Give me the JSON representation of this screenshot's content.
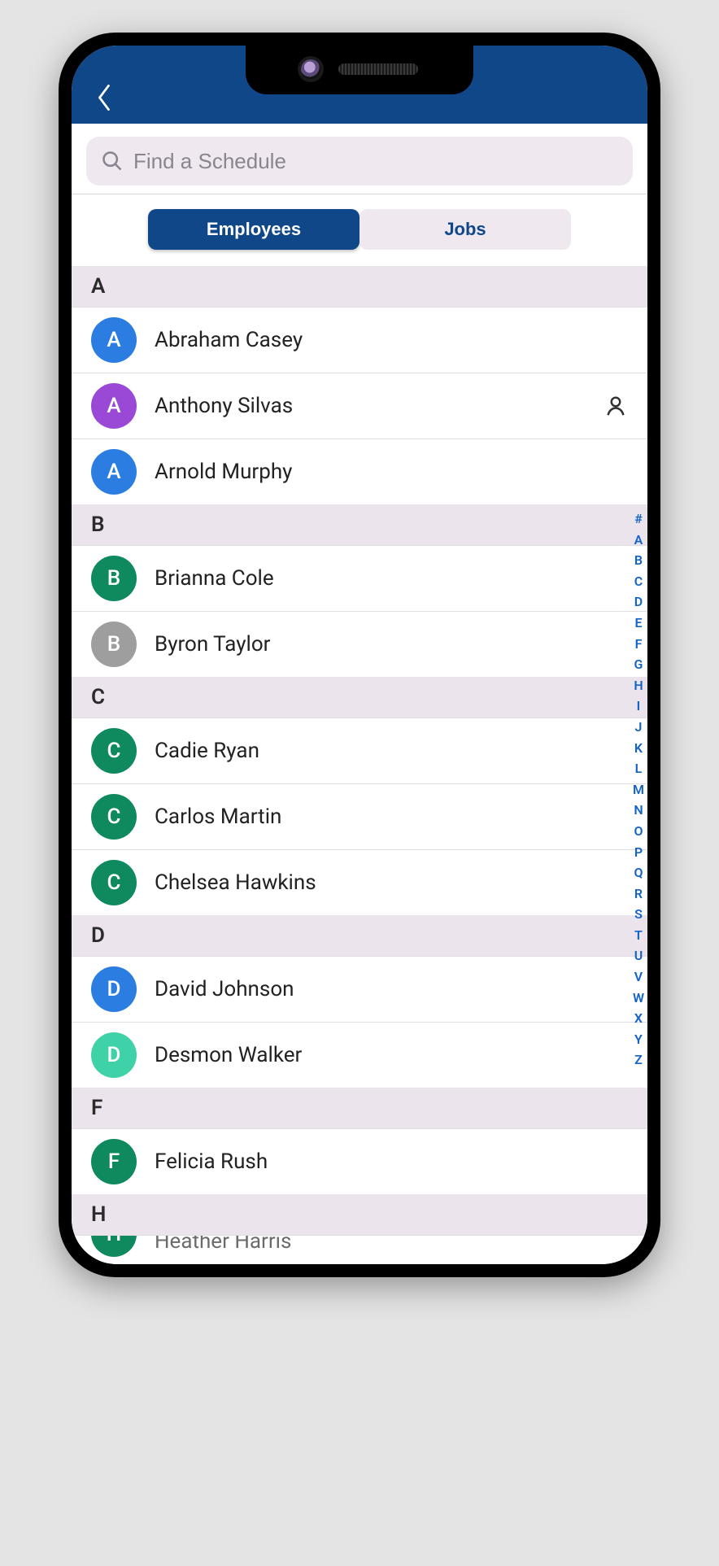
{
  "search": {
    "placeholder": "Find a Schedule"
  },
  "tabs": {
    "employees": "Employees",
    "jobs": "Jobs",
    "active": "employees"
  },
  "avatar_colors": {
    "blue": "#2b7de1",
    "purple": "#9a48d6",
    "green": "#0f8a5f",
    "grey": "#9e9e9e",
    "teal": "#3fd1a8"
  },
  "sections": [
    {
      "letter": "A",
      "items": [
        {
          "initial": "A",
          "name": "Abraham Casey",
          "color": "blue",
          "profile": false
        },
        {
          "initial": "A",
          "name": "Anthony Silvas",
          "color": "purple",
          "profile": true
        },
        {
          "initial": "A",
          "name": "Arnold Murphy",
          "color": "blue",
          "profile": false
        }
      ]
    },
    {
      "letter": "B",
      "items": [
        {
          "initial": "B",
          "name": "Brianna Cole",
          "color": "green",
          "profile": false
        },
        {
          "initial": "B",
          "name": "Byron Taylor",
          "color": "grey",
          "profile": false
        }
      ]
    },
    {
      "letter": "C",
      "items": [
        {
          "initial": "C",
          "name": "Cadie Ryan",
          "color": "green",
          "profile": false
        },
        {
          "initial": "C",
          "name": "Carlos Martin",
          "color": "green",
          "profile": false
        },
        {
          "initial": "C",
          "name": "Chelsea Hawkins",
          "color": "green",
          "profile": false
        }
      ]
    },
    {
      "letter": "D",
      "items": [
        {
          "initial": "D",
          "name": "David Johnson",
          "color": "blue",
          "profile": false
        },
        {
          "initial": "D",
          "name": "Desmon Walker",
          "color": "teal",
          "profile": false
        }
      ]
    },
    {
      "letter": "F",
      "items": [
        {
          "initial": "F",
          "name": "Felicia Rush",
          "color": "green",
          "profile": false
        }
      ]
    },
    {
      "letter": "H",
      "cut": true,
      "items": [
        {
          "initial": "H",
          "name": "Heather Harris",
          "color": "green",
          "profile": false,
          "cut": true
        }
      ]
    }
  ],
  "index_letters": [
    "#",
    "A",
    "B",
    "C",
    "D",
    "E",
    "F",
    "G",
    "H",
    "I",
    "J",
    "K",
    "L",
    "M",
    "N",
    "O",
    "P",
    "Q",
    "R",
    "S",
    "T",
    "U",
    "V",
    "W",
    "X",
    "Y",
    "Z"
  ]
}
